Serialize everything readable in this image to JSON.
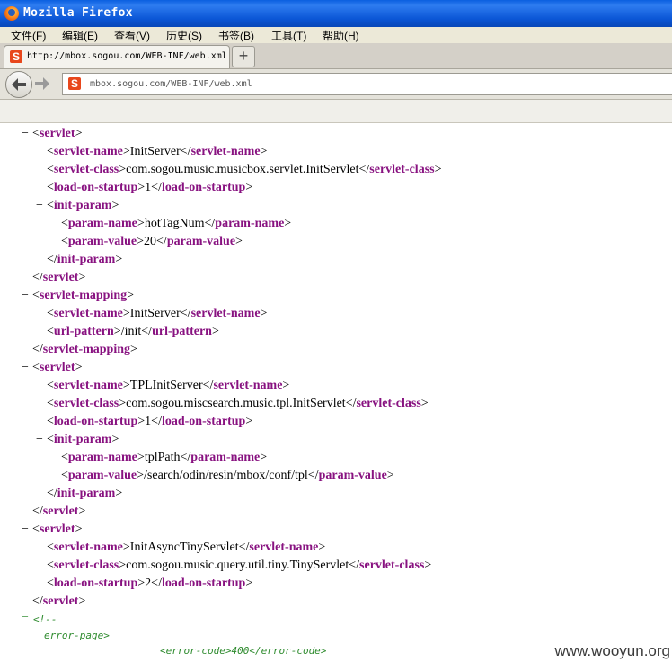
{
  "window": {
    "title": "Mozilla Firefox"
  },
  "menu": [
    "文件(F)",
    "编辑(E)",
    "查看(V)",
    "历史(S)",
    "书签(B)",
    "工具(T)",
    "帮助(H)"
  ],
  "tab": {
    "title": "http://mbox.sogou.com/WEB-INF/web.xml",
    "icon": "S"
  },
  "address_bar": {
    "url": "mbox.sogou.com/WEB-INF/web.xml",
    "icon": "S"
  },
  "xml_lines": [
    {
      "open": "servlet",
      "content": "",
      "close": ""
    },
    {
      "open": "servlet-name",
      "content": "InitServer",
      "close": "servlet-name"
    },
    {
      "open": "servlet-class",
      "content": "com.sogou.music.musicbox.servlet.InitServlet",
      "close": "servlet-class"
    },
    {
      "open": "load-on-startup",
      "content": "1",
      "close": "load-on-startup"
    },
    {
      "open": "init-param",
      "content": "",
      "close": ""
    },
    {
      "open": "param-name",
      "content": "hotTagNum",
      "close": "param-name"
    },
    {
      "open": "param-value",
      "content": "20",
      "close": "param-value"
    },
    {
      "open": "",
      "content": "",
      "close": "init-param"
    },
    {
      "open": "",
      "content": "",
      "close": "servlet"
    },
    {
      "open": "servlet-mapping",
      "content": "",
      "close": ""
    },
    {
      "open": "servlet-name",
      "content": "InitServer",
      "close": "servlet-name"
    },
    {
      "open": "url-pattern",
      "content": "/init",
      "close": "url-pattern"
    },
    {
      "open": "",
      "content": "",
      "close": "servlet-mapping"
    },
    {
      "open": "servlet",
      "content": "",
      "close": ""
    },
    {
      "open": "servlet-name",
      "content": "TPLInitServer",
      "close": "servlet-name"
    },
    {
      "open": "servlet-class",
      "content": "com.sogou.miscsearch.music.tpl.InitServlet",
      "close": "servlet-class"
    },
    {
      "open": "load-on-startup",
      "content": "1",
      "close": "load-on-startup"
    },
    {
      "open": "init-param",
      "content": "",
      "close": ""
    },
    {
      "open": "param-name",
      "content": "tplPath",
      "close": "param-name"
    },
    {
      "open": "param-value",
      "content": "/search/odin/resin/mbox/conf/tpl",
      "close": "param-value"
    },
    {
      "open": "",
      "content": "",
      "close": "init-param"
    },
    {
      "open": "",
      "content": "",
      "close": "servlet"
    },
    {
      "open": "servlet",
      "content": "",
      "close": ""
    },
    {
      "open": "servlet-name",
      "content": "InitAsyncTinyServlet",
      "close": "servlet-name"
    },
    {
      "open": "servlet-class",
      "content": "com.sogou.music.query.util.tiny.TinyServlet",
      "close": "servlet-class"
    },
    {
      "open": "load-on-startup",
      "content": "2",
      "close": "load-on-startup"
    },
    {
      "open": "",
      "content": "",
      "close": "servlet"
    }
  ],
  "comment": {
    "start": "<!--",
    "line1": "error-page>",
    "line2": "<error-code>400</error-code>"
  },
  "watermark": "www.wooyun.org"
}
